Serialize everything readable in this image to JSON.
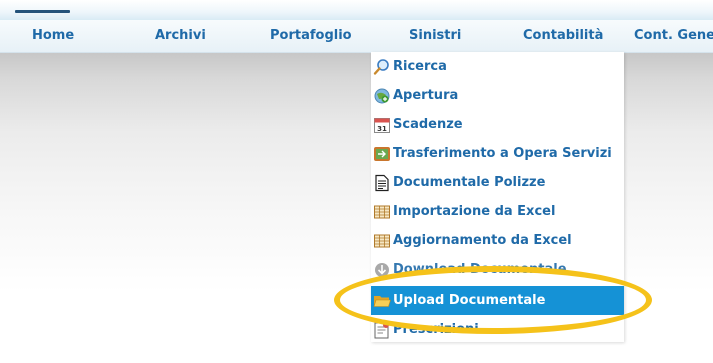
{
  "menubar": {
    "items": [
      {
        "label": "Home"
      },
      {
        "label": "Archivi"
      },
      {
        "label": "Portafoglio"
      },
      {
        "label": "Sinistri"
      },
      {
        "label": "Contabilità"
      },
      {
        "label": "Cont. Gene"
      }
    ]
  },
  "dropdown": {
    "parent": "Sinistri",
    "items": [
      {
        "label": "Ricerca",
        "icon": "magnifier-icon"
      },
      {
        "label": "Apertura",
        "icon": "globe-plus-icon"
      },
      {
        "label": "Scadenze",
        "icon": "calendar-icon",
        "icon_text": "31"
      },
      {
        "label": "Trasferimento a Opera Servizi",
        "icon": "transfer-icon"
      },
      {
        "label": "Documentale Polizze",
        "icon": "document-icon"
      },
      {
        "label": "Importazione da Excel",
        "icon": "spreadsheet-icon"
      },
      {
        "label": "Aggiornamento da Excel",
        "icon": "spreadsheet-icon"
      },
      {
        "label": "Download Documentale",
        "icon": "download-icon"
      },
      {
        "label": "Upload Documentale",
        "icon": "folder-open-icon",
        "active": true
      },
      {
        "label": "Prescrizioni",
        "icon": "prescription-icon"
      }
    ]
  },
  "colors": {
    "menu_text": "#1f6aa8",
    "active_bg": "#1592d6",
    "highlight_ring": "#f5c21a"
  }
}
